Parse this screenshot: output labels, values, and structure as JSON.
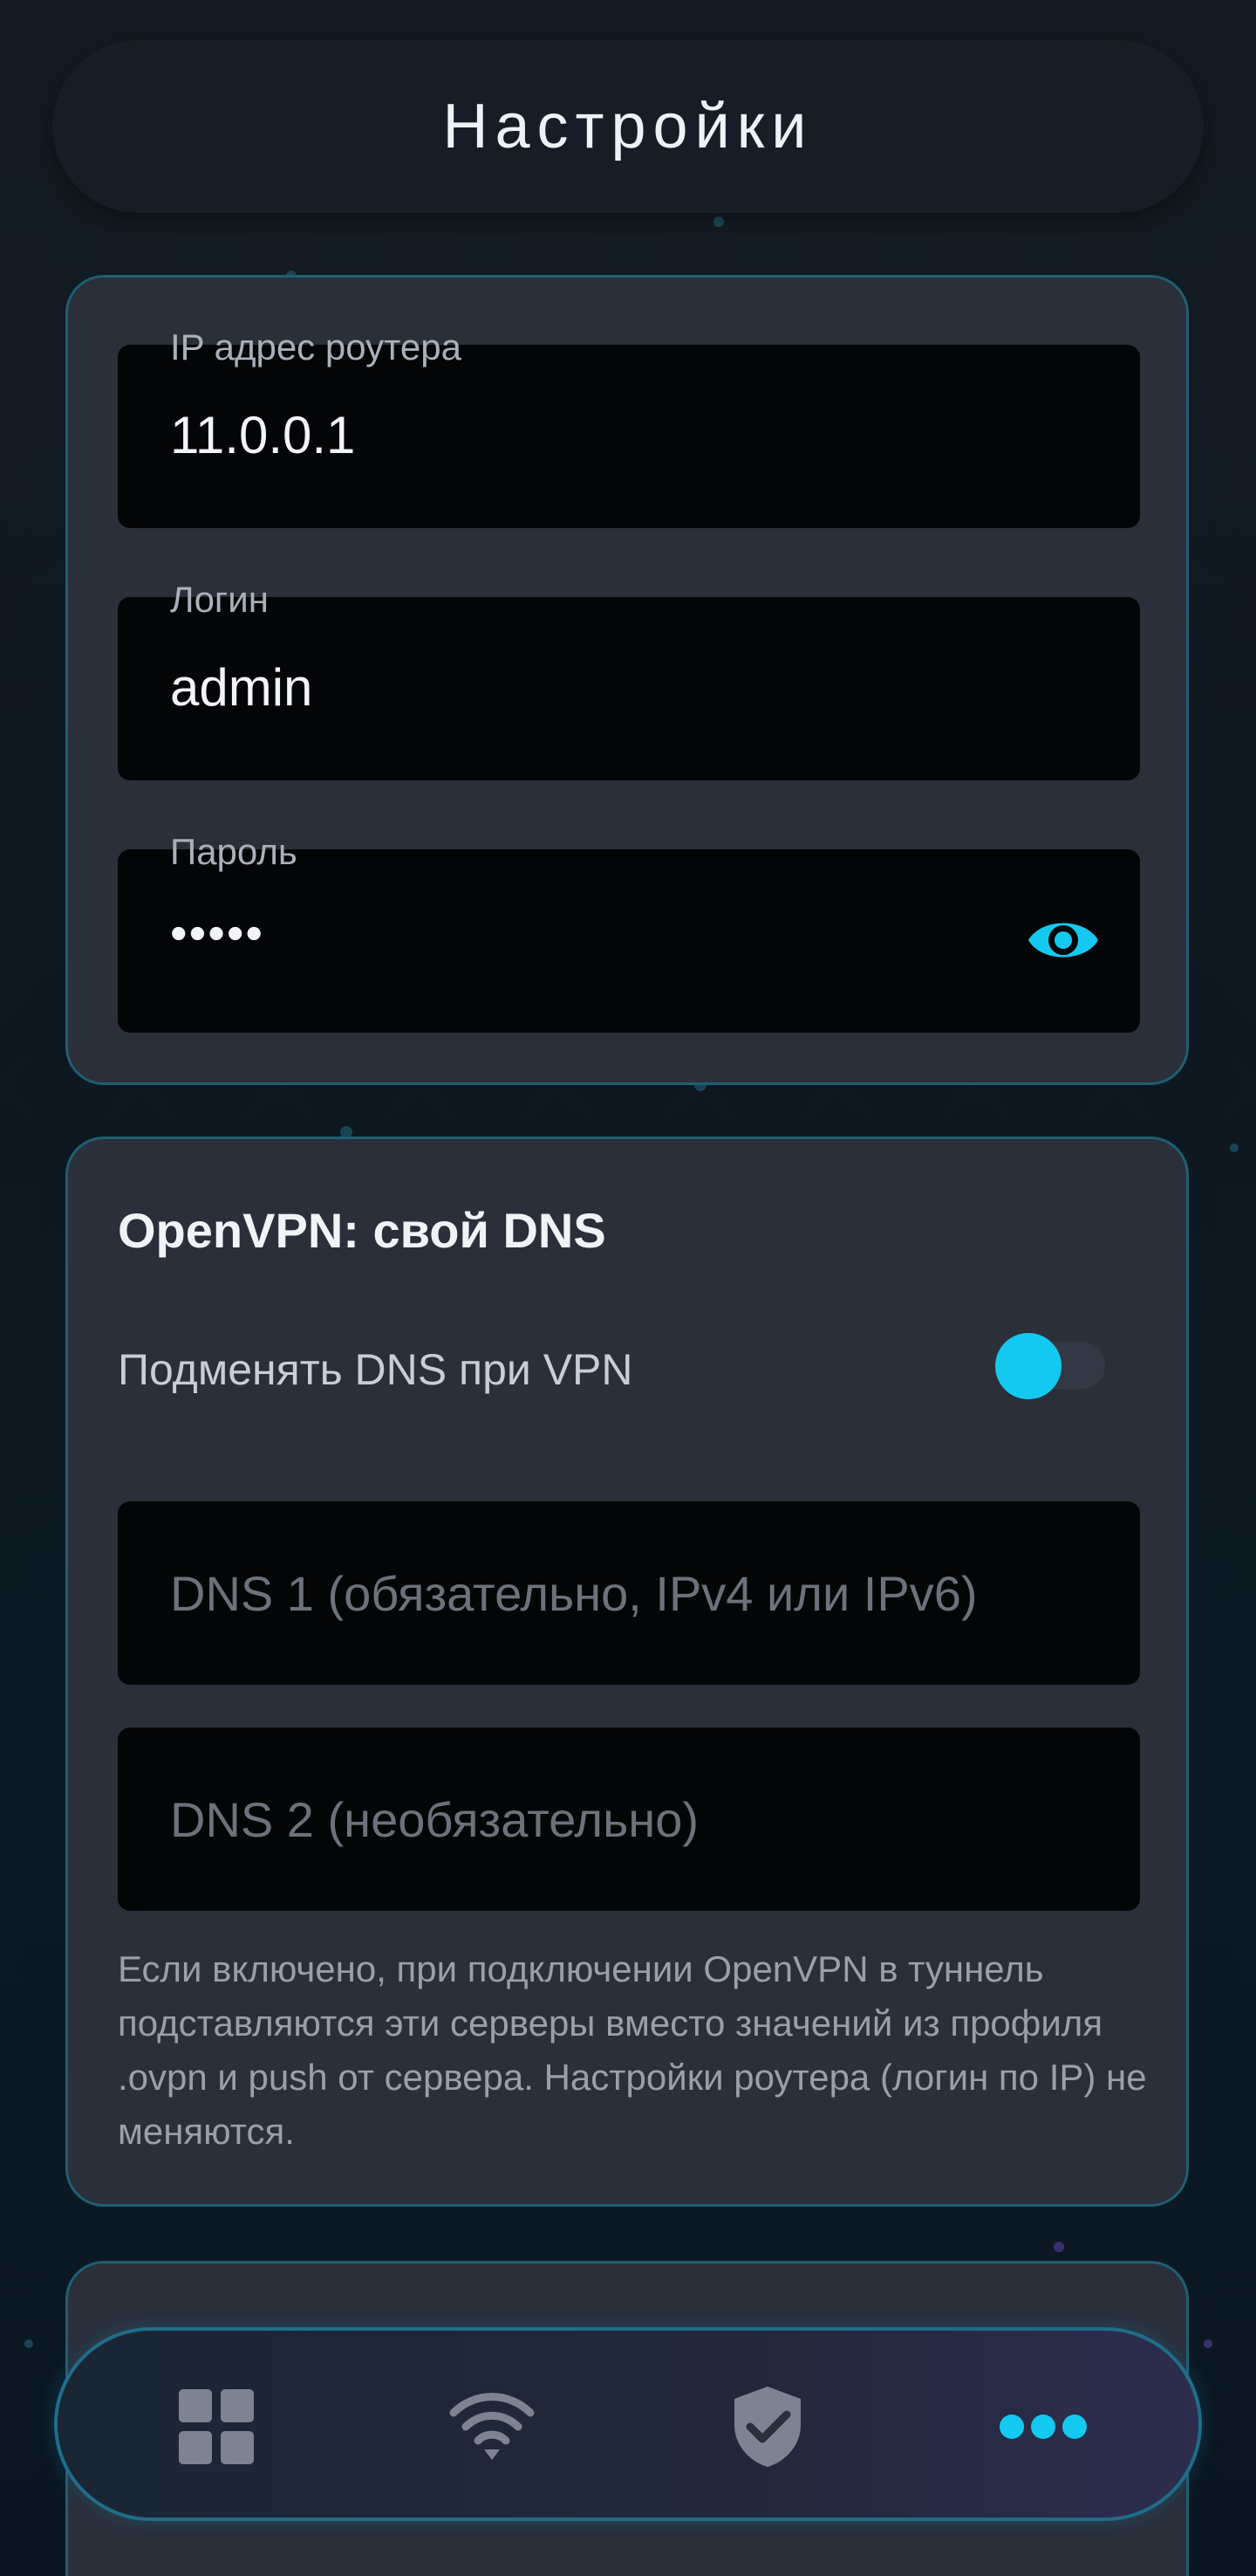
{
  "header": {
    "title": "Настройки"
  },
  "connection": {
    "ip": {
      "label": "IP адрес роутера",
      "value": "11.0.0.1"
    },
    "login": {
      "label": "Логин",
      "value": "admin"
    },
    "password": {
      "label": "Пароль",
      "value": "•••••",
      "visibility_icon": "eye-icon"
    }
  },
  "dns": {
    "title": "OpenVPN: свой DNS",
    "toggle_label": "Подменять DNS при VPN",
    "toggle_on": true,
    "dns1_placeholder": "DNS 1 (обязательно, IPv4 или IPv6)",
    "dns2_placeholder": "DNS 2 (необязательно)",
    "note": "Если включено, при подключении OpenVPN в туннель подставляются эти серверы вместо значений из профиля .ovpn и push от сервера. Настройки роутера (логин по IP) не меняются."
  },
  "nav": {
    "items": [
      {
        "icon": "dashboard-grid-icon",
        "active": false
      },
      {
        "icon": "wifi-icon",
        "active": false
      },
      {
        "icon": "shield-check-icon",
        "active": false
      },
      {
        "icon": "more-dots-icon",
        "active": true
      }
    ]
  },
  "colors": {
    "accent": "#14c9ef",
    "card_bg": "#2a2f3a",
    "card_border": "#1e5f72",
    "field_bg": "#040506",
    "nav_inactive": "#7d8390"
  }
}
